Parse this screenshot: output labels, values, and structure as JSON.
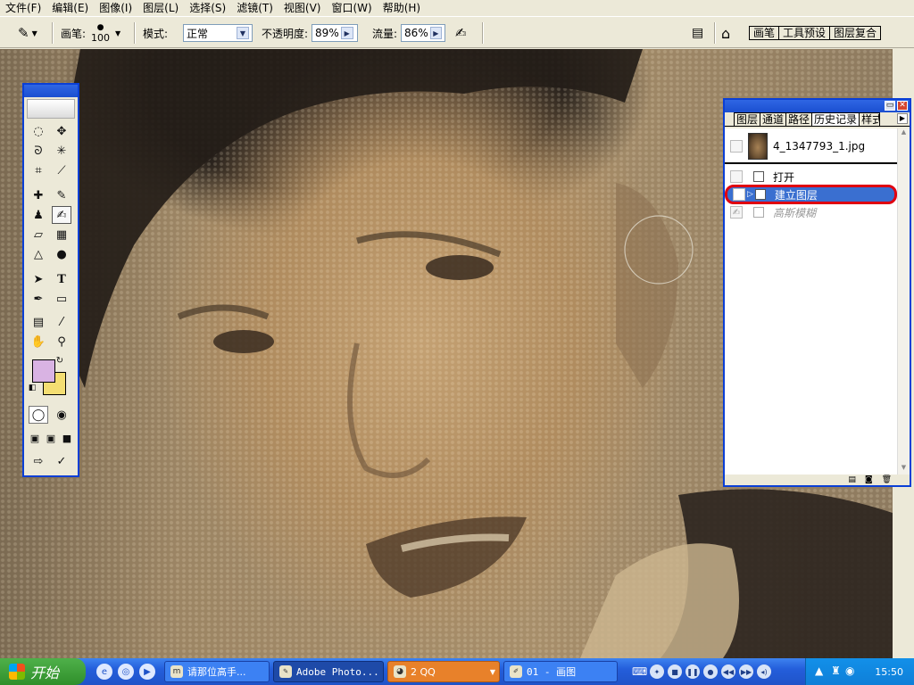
{
  "menu": [
    "文件(F)",
    "编辑(E)",
    "图像(I)",
    "图层(L)",
    "选择(S)",
    "滤镜(T)",
    "视图(V)",
    "窗口(W)",
    "帮助(H)"
  ],
  "options": {
    "brush_label": "画笔:",
    "brush_size": "100",
    "mode_label": "模式:",
    "mode_value": "正常",
    "opacity_label": "不透明度:",
    "opacity_value": "89%",
    "flow_label": "流量:",
    "flow_value": "86%"
  },
  "dock_tabs": [
    "画笔",
    "工具预设",
    "图层复合"
  ],
  "panel": {
    "tabs": [
      "图层",
      "通道",
      "路径",
      "历史记录",
      "样式"
    ],
    "active_tab": "历史记录",
    "snapshot_name": "4_1347793_1.jpg",
    "history": [
      {
        "label": "打开",
        "state": "normal"
      },
      {
        "label": "建立图层",
        "state": "selected"
      },
      {
        "label": "高斯模糊",
        "state": "inactive"
      }
    ]
  },
  "toolbox": {
    "foreground_color": "#d9b3e3",
    "background_color": "#f4de72"
  },
  "taskbar": {
    "start_label": "开始",
    "tasks": [
      {
        "label": "请那位高手...",
        "active": false
      },
      {
        "label": "Adobe Photo...",
        "active": true
      },
      {
        "label": "2 QQ",
        "active": false
      },
      {
        "label": "01 - 画图",
        "active": false
      }
    ],
    "clock": "15:50"
  }
}
